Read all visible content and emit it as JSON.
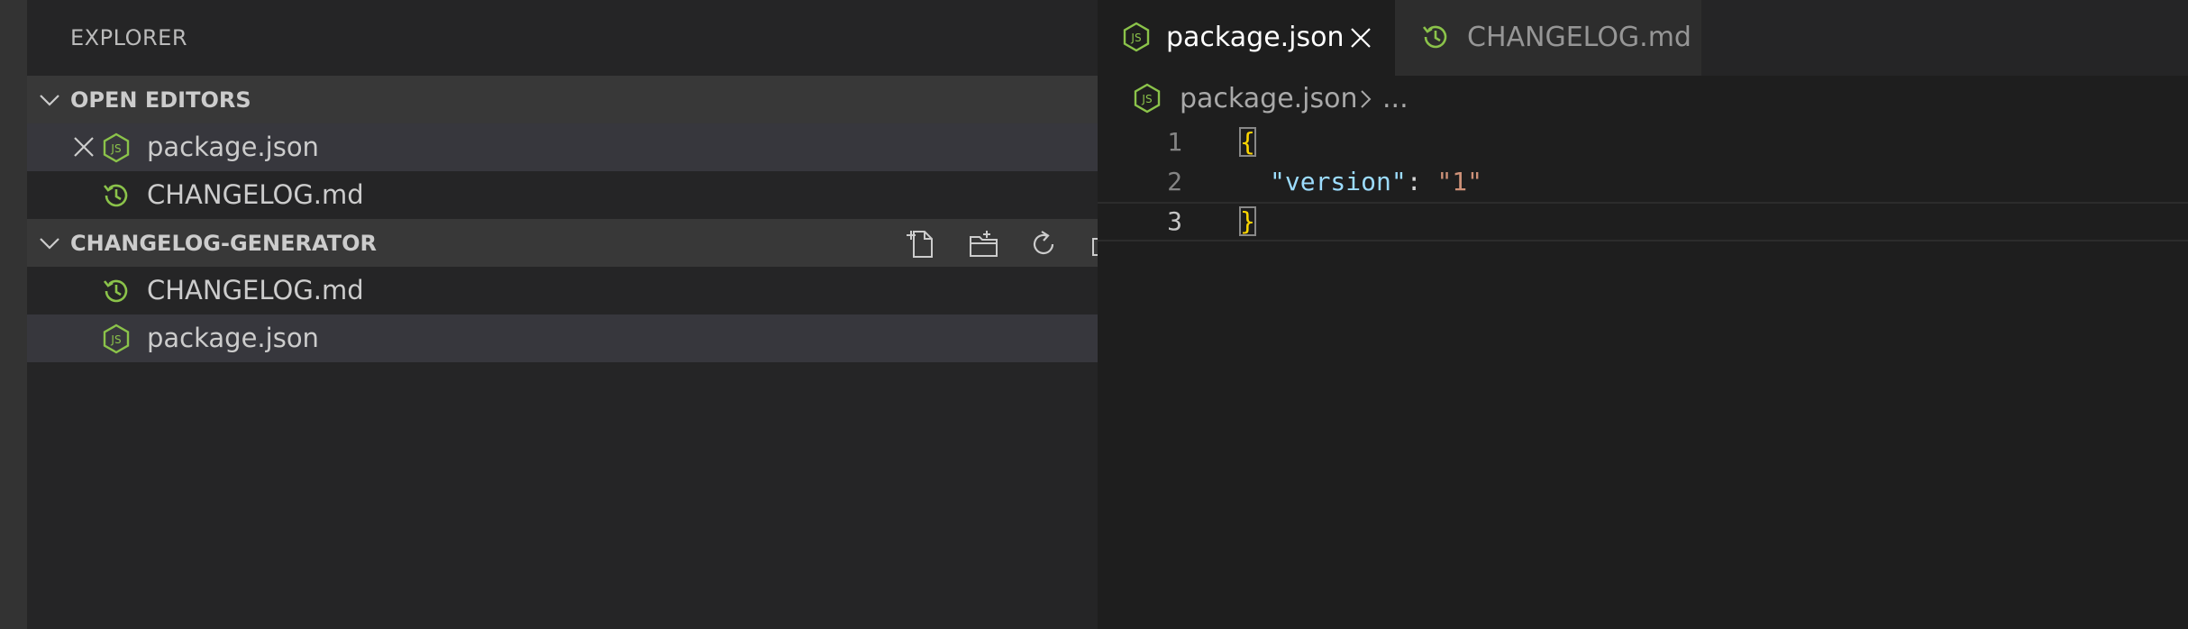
{
  "sidebar": {
    "title": "EXPLORER",
    "open_editors": {
      "header": "OPEN EDITORS",
      "items": [
        {
          "label": "package.json",
          "icon": "nodejs-icon"
        },
        {
          "label": "CHANGELOG.md",
          "icon": "history-icon"
        }
      ]
    },
    "workspace": {
      "header": "CHANGELOG-GENERATOR",
      "actions": [
        "new-file-icon",
        "new-folder-icon",
        "refresh-icon",
        "collapse-all-icon"
      ],
      "items": [
        {
          "label": "CHANGELOG.md",
          "icon": "history-icon"
        },
        {
          "label": "package.json",
          "icon": "nodejs-icon"
        }
      ]
    }
  },
  "editor": {
    "tabs": [
      {
        "label": "package.json",
        "active": true,
        "icon": "nodejs-icon"
      },
      {
        "label": "CHANGELOG.md",
        "active": false,
        "icon": "history-icon"
      }
    ],
    "breadcrumb": {
      "file": "package.json",
      "ellipsis": "..."
    },
    "lines": [
      {
        "number": "1",
        "text": "{"
      },
      {
        "number": "2",
        "key": "\"version\"",
        "colon": ": ",
        "value": "\"1\""
      },
      {
        "number": "3",
        "text": "}"
      }
    ]
  },
  "colors": {
    "node_green": "#8bc34a",
    "history_green": "#8bc34a",
    "json_key": "#9cdcfe",
    "json_string": "#ce9178",
    "brace": "#ffd700"
  }
}
